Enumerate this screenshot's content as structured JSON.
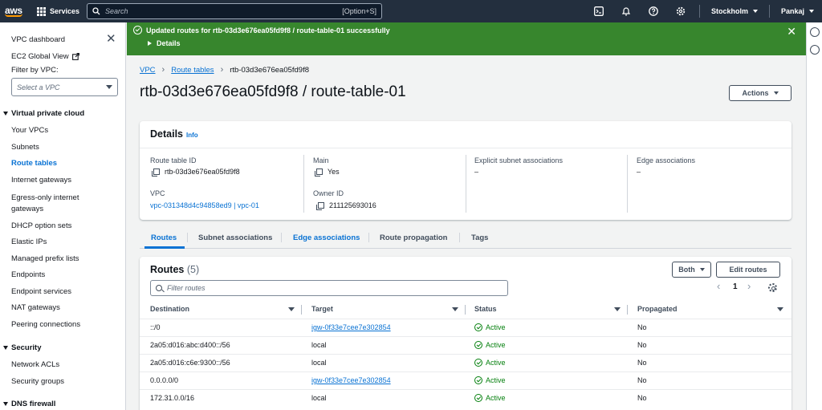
{
  "topnav": {
    "logo": "aws",
    "services": "Services",
    "search_placeholder": "Search",
    "search_shortcut": "[Option+S]",
    "region": "Stockholm",
    "user": "Pankaj",
    "icons": [
      "cloudshell-icon",
      "bell-icon",
      "help-icon",
      "settings-icon"
    ]
  },
  "sidebar": {
    "dashboard": "VPC dashboard",
    "ec2_global_view": "EC2 Global View",
    "filter_label": "Filter by VPC:",
    "select_placeholder": "Select a VPC",
    "sections": [
      {
        "title": "Virtual private cloud",
        "items": [
          "Your VPCs",
          "Subnets",
          "Route tables",
          "Internet gateways",
          "Egress-only internet gateways",
          "DHCP option sets",
          "Elastic IPs",
          "Managed prefix lists",
          "Endpoints",
          "Endpoint services",
          "NAT gateways",
          "Peering connections"
        ]
      },
      {
        "title": "Security",
        "items": [
          "Network ACLs",
          "Security groups"
        ]
      },
      {
        "title": "DNS firewall",
        "items": []
      }
    ],
    "egress_line1": "Egress-only internet",
    "egress_line2": "gateways",
    "active_item": "Route tables"
  },
  "flash": {
    "message": "Updated routes for rtb-03d3e676ea05fd9f8 / route-table-01 successfully",
    "details": "Details",
    "color": "#37862d"
  },
  "breadcrumb": [
    "VPC",
    "Route tables",
    "rtb-03d3e676ea05fd9f8"
  ],
  "page": {
    "title": "rtb-03d3e676ea05fd9f8 / route-table-01",
    "actions": "Actions"
  },
  "details": {
    "title": "Details",
    "info": "Info",
    "route_table_id_label": "Route table ID",
    "route_table_id": "rtb-03d3e676ea05fd9f8",
    "main_label": "Main",
    "main": "Yes",
    "explicit_label": "Explicit subnet associations",
    "explicit": "–",
    "edge_label": "Edge associations",
    "edge": "–",
    "vpc_label": "VPC",
    "vpc": "vpc-031348d4c94858ed9 | vpc-01",
    "owner_label": "Owner ID",
    "owner": "211125693016"
  },
  "tabs": [
    "Routes",
    "Subnet associations",
    "Edge associations",
    "Route propagation",
    "Tags"
  ],
  "routes": {
    "title": "Routes",
    "count": "(5)",
    "both": "Both",
    "edit": "Edit routes",
    "filter_placeholder": "Filter routes",
    "page": "1",
    "columns": [
      "Destination",
      "Target",
      "Status",
      "Propagated"
    ],
    "rows": [
      {
        "destination": "::/0",
        "target": "igw-0f33e7cee7e302854",
        "status": "Active",
        "propagated": "No"
      },
      {
        "destination": "2a05:d016:abc:d400::/56",
        "target": "local",
        "status": "Active",
        "propagated": "No"
      },
      {
        "destination": "2a05:d016:c6e:9300::/56",
        "target": "local",
        "status": "Active",
        "propagated": "No"
      },
      {
        "destination": "0.0.0.0/0",
        "target": "igw-0f33e7cee7e302854",
        "status": "Active",
        "propagated": "No"
      },
      {
        "destination": "172.31.0.0/16",
        "target": "local",
        "status": "Active",
        "propagated": "No"
      }
    ]
  },
  "colors": {
    "nav": "#232f3e",
    "link": "#0972d3",
    "success": "#037f0c",
    "accent": "#ff9900"
  }
}
